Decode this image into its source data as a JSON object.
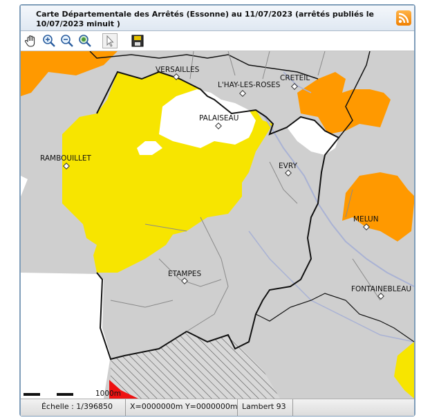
{
  "title": "Carte Départementale des Arrêtés (Essonne) au 11/07/2023 (arrêtés publiés le 10/07/2023 minuit )",
  "rss_icon": "rss-feed-icon",
  "toolbar": {
    "tools": [
      {
        "icon": "pan-hand-icon"
      },
      {
        "icon": "zoom-in-icon"
      },
      {
        "icon": "zoom-out-icon"
      },
      {
        "icon": "zoom-extent-icon"
      },
      {
        "icon": "select-arrow-icon"
      },
      {
        "icon": "save-icon"
      }
    ]
  },
  "map": {
    "labels": {
      "versailles": "VERSAILLES",
      "lhay": "L'HAY-LES-ROSES",
      "creteil": "CRETEIL",
      "palaiseau": "PALAISEAU",
      "rambouillet": "RAMBOUILLET",
      "evry": "EVRY",
      "melun": "MELUN",
      "etampes": "ETAMPES",
      "fontainebleau": "FONTAINEBLEAU"
    },
    "scale_text": "1000m",
    "colors": {
      "background_grey": "#cfcfcf",
      "yellow_zone": "#f7e500",
      "orange_zone": "#ff9900",
      "white_zone": "#ffffff",
      "red_zone": "#ee1111",
      "border": "#111111",
      "river": "#a9b2d4"
    }
  },
  "status": {
    "scale": "Échelle : 1/396850",
    "coords": "X=0000000m Y=0000000m",
    "projection": "Lambert 93"
  }
}
